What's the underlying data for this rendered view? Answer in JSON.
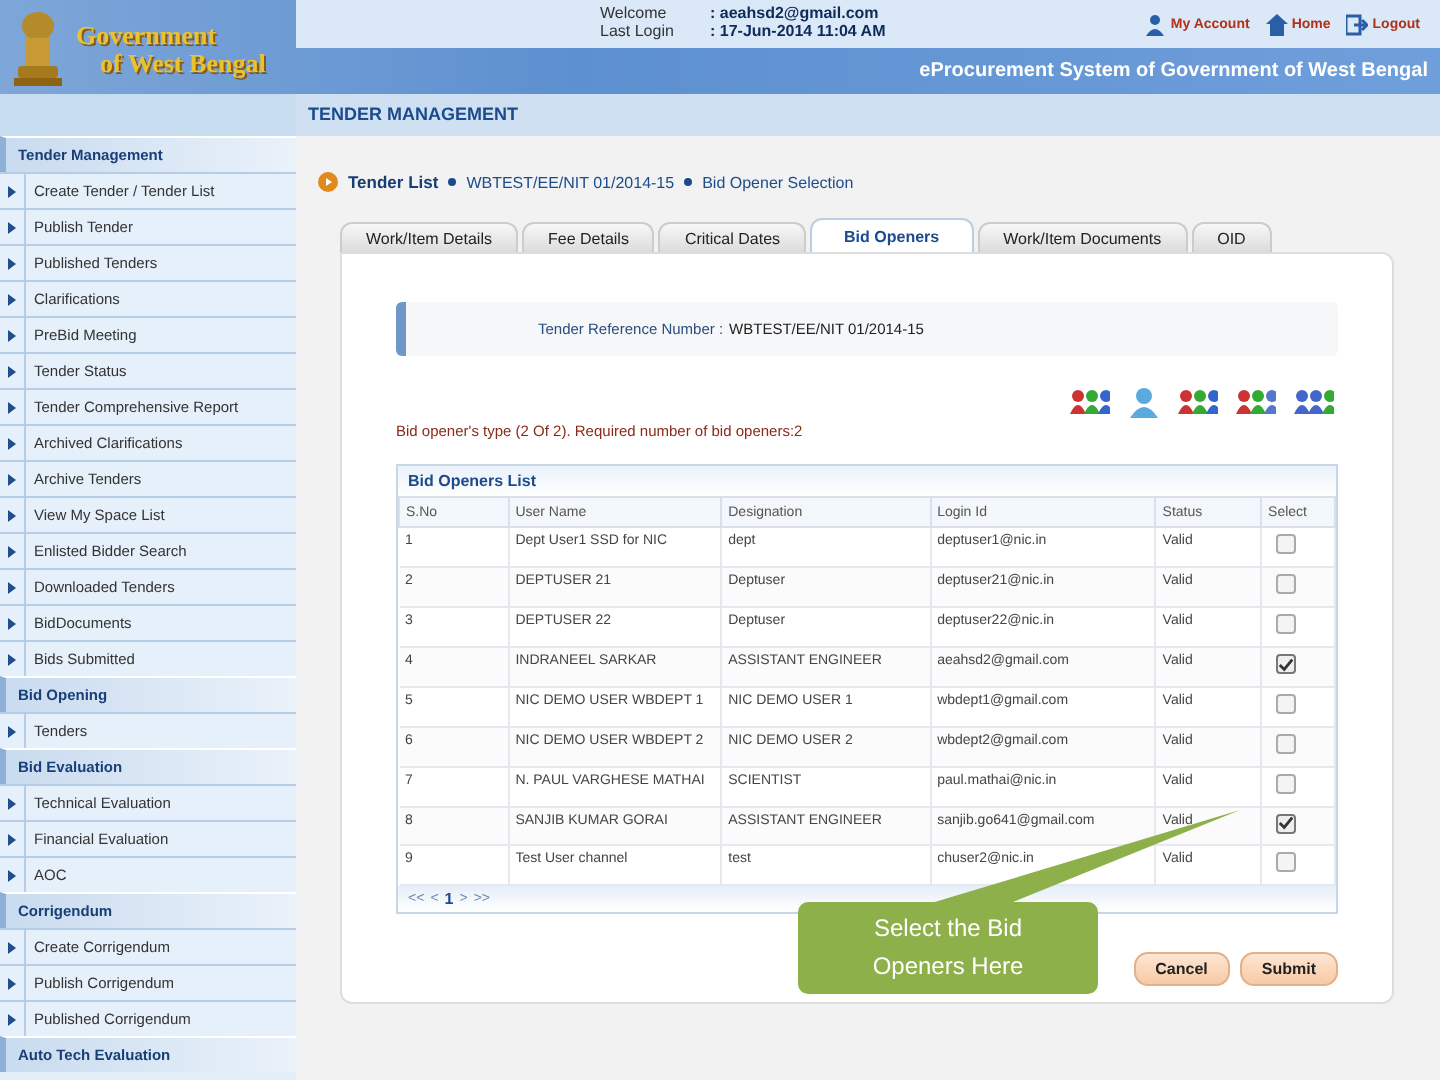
{
  "header": {
    "org_name": [
      "Government",
      "of West Bengal"
    ],
    "welcome_label": "Welcome",
    "welcome_value": ": aeahsd2@gmail.com",
    "last_login_label": "Last Login",
    "last_login_value": ": 17-Jun-2014 11:04 AM",
    "links": [
      "My Account",
      "Home",
      "Logout"
    ],
    "system_title": "eProcurement System of Government of West Bengal"
  },
  "page_title": "TENDER MANAGEMENT",
  "sidebar": {
    "sections": [
      {
        "title": "Tender Management",
        "items": [
          {
            "label": "Create Tender / Tender List"
          },
          {
            "label": "Publish Tender"
          },
          {
            "label": "Published Tenders"
          },
          {
            "label": "Clarifications"
          },
          {
            "label": "PreBid Meeting"
          },
          {
            "label": "Tender Status"
          },
          {
            "label": "Tender Comprehensive Report"
          },
          {
            "label": "Archived Clarifications"
          },
          {
            "label": "Archive Tenders"
          },
          {
            "label": "View My Space List"
          },
          {
            "label": "Enlisted Bidder Search"
          },
          {
            "label": "Downloaded Tenders"
          },
          {
            "label": "BidDocuments"
          },
          {
            "label": "Bids Submitted"
          }
        ]
      },
      {
        "title": "Bid Opening",
        "items": [
          {
            "label": "Tenders"
          }
        ]
      },
      {
        "title": "Bid Evaluation",
        "items": [
          {
            "label": "Technical Evaluation"
          },
          {
            "label": "Financial Evaluation"
          },
          {
            "label": "AOC"
          }
        ]
      },
      {
        "title": "Corrigendum",
        "items": [
          {
            "label": "Create Corrigendum"
          },
          {
            "label": "Publish Corrigendum"
          },
          {
            "label": "Published Corrigendum"
          }
        ]
      },
      {
        "title": "Auto Tech Evaluation"
      }
    ]
  },
  "breadcrumb": [
    "Tender List",
    "WBTEST/EE/NIT 01/2014-15",
    "Bid Opener Selection"
  ],
  "tabs": [
    {
      "label": "Work/Item Details",
      "selected": false
    },
    {
      "label": "Fee Details",
      "selected": false
    },
    {
      "label": "Critical Dates",
      "selected": false
    },
    {
      "label": "Bid Openers",
      "selected": true
    },
    {
      "label": "Work/Item Documents",
      "selected": false
    },
    {
      "label": "OID",
      "selected": false
    }
  ],
  "reference": {
    "label": "Tender Reference Number :",
    "value": "WBTEST/EE/NIT 01/2014-15"
  },
  "opener_note": "Bid opener's type (2 Of 2). Required number of bid openers:2",
  "table": {
    "title": "Bid Openers List",
    "columns": [
      "S.No",
      "User Name",
      "Designation",
      "Login Id",
      "Status",
      "Select"
    ],
    "rows": [
      {
        "cells": [
          "1",
          "Dept User1 SSD for NIC",
          "dept",
          "deptuser1@nic.in",
          "Valid"
        ],
        "checked": false
      },
      {
        "cells": [
          "2",
          "DEPTUSER 21",
          "Deptuser",
          "deptuser21@nic.in",
          "Valid"
        ],
        "checked": false
      },
      {
        "cells": [
          "3",
          "DEPTUSER 22",
          "Deptuser",
          "deptuser22@nic.in",
          "Valid"
        ],
        "checked": false
      },
      {
        "cells": [
          "4",
          "INDRANEEL SARKAR",
          "ASSISTANT ENGINEER",
          "aeahsd2@gmail.com",
          "Valid"
        ],
        "checked": true
      },
      {
        "cells": [
          "5",
          "NIC DEMO USER WBDEPT 1",
          "NIC DEMO USER 1",
          "wbdept1@gmail.com",
          "Valid"
        ],
        "checked": false
      },
      {
        "cells": [
          "6",
          "NIC DEMO USER WBDEPT 2",
          "NIC DEMO USER 2",
          "wbdept2@gmail.com",
          "Valid"
        ],
        "checked": false
      },
      {
        "cells": [
          "7",
          "N. PAUL VARGHESE MATHAI",
          "SCIENTIST",
          "paul.mathai@nic.in",
          "Valid"
        ],
        "checked": false
      },
      {
        "cells": [
          "8",
          "SANJIB KUMAR GORAI",
          "ASSISTANT ENGINEER",
          "sanjib.go641@gmail.com",
          "Valid"
        ],
        "checked": true
      },
      {
        "cells": [
          "9",
          "Test User channel",
          "test",
          "chuser2@nic.in",
          "Valid"
        ],
        "checked": false
      }
    ],
    "pager": [
      "<<",
      "<",
      "1",
      ">",
      ">>"
    ]
  },
  "buttons": [
    "Cancel",
    "Submit"
  ],
  "callout": {
    "text": "Select the Bid Openers Here"
  }
}
